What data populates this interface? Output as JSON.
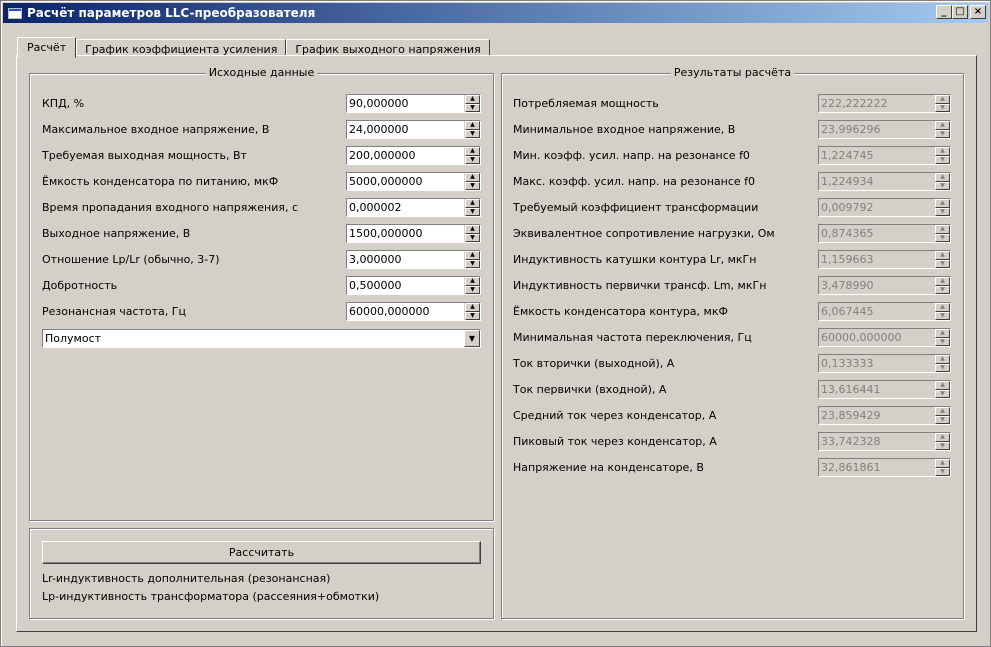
{
  "window": {
    "title": "Расчёт параметров LLC-преобразователя"
  },
  "window_controls": {
    "minimize": "_",
    "maximize": "□",
    "close": "×"
  },
  "tabs": [
    {
      "label": "Расчёт",
      "active": true
    },
    {
      "label": "График коэффициента усиления",
      "active": false
    },
    {
      "label": "График выходного напряжения",
      "active": false
    }
  ],
  "inputs": {
    "title": "Исходные данные",
    "fields": [
      {
        "label": "КПД, %",
        "value": "90,000000"
      },
      {
        "label": "Максимальное входное напряжение, В",
        "value": "24,000000"
      },
      {
        "label": "Требуемая выходная мощность, Вт",
        "value": "200,000000"
      },
      {
        "label": "Ёмкость конденсатора по питанию, мкФ",
        "value": "5000,000000"
      },
      {
        "label": "Время пропадания входного напряжения, с",
        "value": "0,000002"
      },
      {
        "label": "Выходное напряжение, В",
        "value": "1500,000000"
      },
      {
        "label": "Отношение Lp/Lr (обычно, 3-7)",
        "value": "3,000000"
      },
      {
        "label": "Добротность",
        "value": "0,500000"
      },
      {
        "label": "Резонансная частота, Гц",
        "value": "60000,000000"
      }
    ],
    "topology": "Полумост"
  },
  "actions": {
    "calculate_label": "Рассчитать",
    "note1": "Lr-индуктивность дополнительная (резонансная)",
    "note2": "Lp-индуктивность трансформатора (рассеяния+обмотки)"
  },
  "results": {
    "title": "Результаты расчёта",
    "fields": [
      {
        "label": "Потребляемая мощность",
        "value": "222,222222"
      },
      {
        "label": "Минимальное входное напряжение, В",
        "value": "23,996296"
      },
      {
        "label": "Мин. коэфф. усил. напр. на резонансе f0",
        "value": "1,224745"
      },
      {
        "label": "Макс. коэфф. усил. напр. на резонансе f0",
        "value": "1,224934"
      },
      {
        "label": "Требуемый коэффициент трансформации",
        "value": "0,009792"
      },
      {
        "label": "Эквивалентное сопротивление нагрузки, Ом",
        "value": "0,874365"
      },
      {
        "label": "Индуктивность катушки контура Lr, мкГн",
        "value": "1,159663"
      },
      {
        "label": "Индуктивность первички трансф. Lm, мкГн",
        "value": "3,478990"
      },
      {
        "label": "Ёмкость конденсатора контура, мкФ",
        "value": "6,067445"
      },
      {
        "label": "Минимальная частота переключения, Гц",
        "value": "60000,000000"
      },
      {
        "label": "Ток вторички (выходной), А",
        "value": "0,133333"
      },
      {
        "label": "Ток первички (входной), А",
        "value": "13,616441"
      },
      {
        "label": "Средний ток через конденсатор, А",
        "value": "23,859429"
      },
      {
        "label": "Пиковый ток через конденсатор, А",
        "value": "33,742328"
      },
      {
        "label": "Напряжение на конденсаторе, В",
        "value": "32,861861"
      }
    ]
  }
}
